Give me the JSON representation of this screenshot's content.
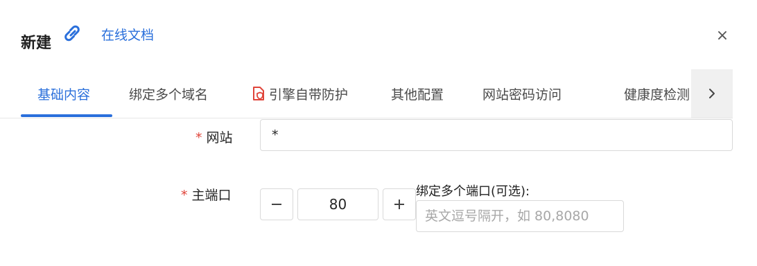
{
  "dialog": {
    "title": "新建",
    "online_doc_label": "在线文档",
    "close_glyph": "×"
  },
  "tabs": [
    {
      "label": "基础内容",
      "active": true
    },
    {
      "label": "绑定多个域名"
    },
    {
      "label": "引擎自带防护",
      "icon": "shield-doc-icon"
    },
    {
      "label": "其他配置"
    },
    {
      "label": "网站密码访问"
    },
    {
      "label": "健康度检测"
    }
  ],
  "form": {
    "required_mark": "*",
    "site": {
      "label": "网站",
      "value": "*"
    },
    "port": {
      "label": "主端口",
      "value": "80",
      "decrement_glyph": "−",
      "increment_glyph": "+"
    },
    "extra_ports": {
      "label": "绑定多个端口(可选):",
      "placeholder": "英文逗号隔开，如 80,8080",
      "value": ""
    }
  },
  "colors": {
    "accent": "#2a6fdb",
    "required": "#e0443a",
    "border": "#d9d9d9"
  }
}
